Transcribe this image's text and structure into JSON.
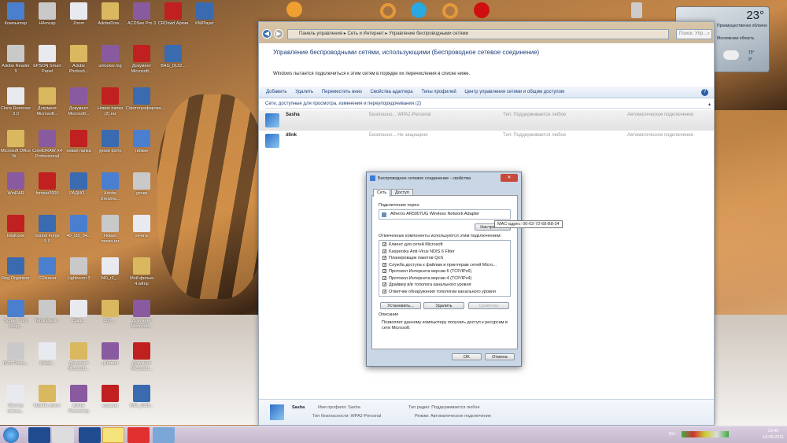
{
  "desktop": {
    "rows": [
      [
        "Компьютер",
        "HAmcap",
        "Zoom",
        "AdobeDow...",
        "ACDSee Pro 3",
        "CRDxwd Архив",
        "KMPlayer"
      ],
      [
        "Adobe Reader 9",
        "EPSON Smart Panel",
        "Adobe Photosh...",
        "unlocker.log",
        "Документ Microsoft...",
        "BAG_0132..."
      ],
      [
        "Clone Remover 3.0",
        "Документ Microsoft...",
        "Документ Microsoft...",
        "Новая папка (2).rar",
        "Сфотографирова..."
      ],
      [
        "Microsoft Office W...",
        "CorelDRAW X4 Professional",
        "новая папка",
        "уроки фото",
        "гибкие"
      ],
      [
        "WinRAR",
        "fontsar2000",
        "РАДИО...",
        "Adobe Dreamw...",
        "уроки"
      ],
      [
        "Intuit.exe",
        "Sound Forge 9.0",
        "40_r30_34...",
        "Новая папка.rar",
        "печать"
      ],
      [
        "Reg Organizer",
        "CCleaner",
        "Lightroom 3",
        "340_r2_...",
        "Мой фильм 4.wlmp"
      ],
      [
        "Screen Tool Snap...",
        "Tenorshare...",
        "Data...",
        "300_...",
        "Документ Microsoft..."
      ],
      [
        "DVD Photo...",
        "Ulead...",
        "Документ Microsoft...",
        "µTorrent",
        "Документ Microsoft..."
      ],
      [
        "Мастер поиска...",
        "Mail.Ru Агент",
        "Adobe Photoshop",
        "корзина",
        "IMG_0008..."
      ]
    ]
  },
  "window": {
    "breadcrumb": [
      "Панель управления",
      "Сеть и Интернет",
      "Управление беспроводными сетями"
    ],
    "search_placeholder": "Поиск: Упр...",
    "title": "Управление беспроводными сетями, использующими (Беспроводное сетевое соединение)",
    "subtitle": "Windows пытается подключиться к этим сетям в порядке их перечисления в списке ниже.",
    "toolbar": [
      "Добавить",
      "Удалить",
      "Переместить вниз",
      "Свойства адаптера",
      "Типы профилей",
      "Центр управления сетями и общим доступом"
    ],
    "group_header": "Сети, доступные для просмотра, изменения и переупорядочивания (2)",
    "networks": [
      {
        "name": "Sasha",
        "security": "Безопасно... WPA2-Personal",
        "type": "Тип: Поддерживается любое",
        "mode": "Автоматическое подключение"
      },
      {
        "name": "dlink",
        "security": "Безопасно... Не защищено",
        "type": "Тип: Поддерживается любое",
        "mode": "Автоматическое подключение"
      }
    ],
    "details": {
      "name": "Sasha",
      "profile": "Имя профиля: Sasha",
      "security": "Тип безопасности: WPA2-Personal",
      "radio": "Тип радио: Поддерживается любое",
      "mode": "Режим: Автоматическое подключение"
    }
  },
  "dialog": {
    "title": "Беспроводное сетевое соединение - свойства",
    "close": "✕",
    "tabs": [
      "Сеть",
      "Доступ"
    ],
    "connect_via_label": "Подключение через:",
    "adapter": "Atheros AR5007UG Wireless Network Adapter",
    "configure": "Настроить...",
    "components_label": "Отмеченные компоненты используются этим подключением:",
    "components": [
      "Клиент для сетей Microsoft",
      "Kaspersky Anti-Virus NDIS 6 Filter",
      "Планировщик пакетов QoS",
      "Служба доступа к файлам и принтерам сетей Micro...",
      "Протокол Интернета версии 6 (TCP/IPv6)",
      "Протокол Интернета версии 4 (TCP/IPv4)",
      "Драйвер в/в тополога канального уровня",
      "Ответчик обнаружения топологии канального уровня"
    ],
    "install": "Установить...",
    "remove": "Удалить",
    "properties": "Свойства",
    "description_label": "Описание",
    "description": "Позволяет данному компьютеру получать доступ к ресурсам в сети Microsoft.",
    "ok": "OK",
    "cancel": "Отмена"
  },
  "tooltip": "MAC-адрес: 00-02-72-68-B8-24",
  "weather": {
    "temp": "23°",
    "condition": "Преимущественно облачно",
    "location": "Московская область",
    "forecast_hi": "15°",
    "forecast_lo": "9°"
  },
  "taskbar": {
    "items": [
      "Windows",
      "Photoshop",
      "Acrobat",
      "Photoshop",
      "Mail.Ru Агент",
      "Opera",
      "Сеть"
    ],
    "lang": "RU",
    "time": "19:40",
    "date": "14.08.2011"
  }
}
